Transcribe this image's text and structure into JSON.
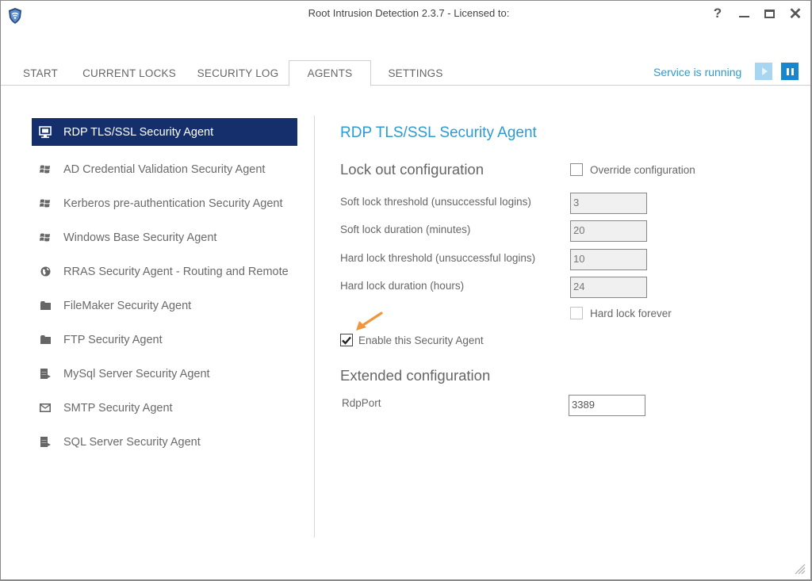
{
  "window": {
    "title": "Root Intrusion Detection 2.3.7 - Licensed to:",
    "controls": {
      "help": "?",
      "minimize": "minimize",
      "maximize": "maximize",
      "close": "✕"
    }
  },
  "tabs": [
    {
      "label": "START",
      "active": false
    },
    {
      "label": "CURRENT LOCKS",
      "active": false
    },
    {
      "label": "SECURITY LOG",
      "active": false
    },
    {
      "label": "AGENTS",
      "active": true
    },
    {
      "label": "SETTINGS",
      "active": false
    }
  ],
  "service": {
    "status_text": "Service is running",
    "play_enabled": false,
    "pause_enabled": true,
    "accent_color": "#2b9bd4"
  },
  "agents": [
    {
      "label": "RDP TLS/SSL Security Agent",
      "icon": "monitor-icon",
      "selected": true
    },
    {
      "label": "AD Credential Validation Security Agent",
      "icon": "windows-logo-icon",
      "selected": false
    },
    {
      "label": "Kerberos pre-authentication Security Agent",
      "icon": "windows-logo-icon",
      "selected": false
    },
    {
      "label": "Windows Base Security Agent",
      "icon": "windows-logo-icon",
      "selected": false
    },
    {
      "label": "RRAS Security Agent - Routing and Remote",
      "icon": "globe-icon",
      "selected": false
    },
    {
      "label": "FileMaker Security Agent",
      "icon": "folder-icon",
      "selected": false
    },
    {
      "label": "FTP Security Agent",
      "icon": "folder-icon",
      "selected": false
    },
    {
      "label": "MySql Server Security Agent",
      "icon": "database-icon",
      "selected": false
    },
    {
      "label": "SMTP Security Agent",
      "icon": "envelope-icon",
      "selected": false
    },
    {
      "label": "SQL Server Security Agent",
      "icon": "database-icon",
      "selected": false
    }
  ],
  "detail": {
    "title": "RDP TLS/SSL Security Agent",
    "lockout": {
      "heading": "Lock out configuration",
      "override_label": "Override configuration",
      "override_checked": false,
      "fields": [
        {
          "label": "Soft lock threshold (unsuccessful logins)",
          "value": "3"
        },
        {
          "label": "Soft lock duration (minutes)",
          "value": "20"
        },
        {
          "label": "Hard lock threshold (unsuccessful logins)",
          "value": "10"
        },
        {
          "label": "Hard lock duration (hours)",
          "value": "24"
        }
      ],
      "hard_lock_forever_label": "Hard lock forever",
      "hard_lock_forever_checked": false
    },
    "enable_label": "Enable this Security Agent",
    "enable_checked": true,
    "extended": {
      "heading": "Extended configuration",
      "fields": [
        {
          "label": "RdpPort",
          "value": "3389"
        }
      ]
    }
  },
  "colors": {
    "selected_bg": "#142f6c",
    "accent": "#2b9bd4",
    "pause_button": "#1687cf",
    "play_button_disabled": "#a8d6f0",
    "annotation_arrow": "#f0963c"
  }
}
